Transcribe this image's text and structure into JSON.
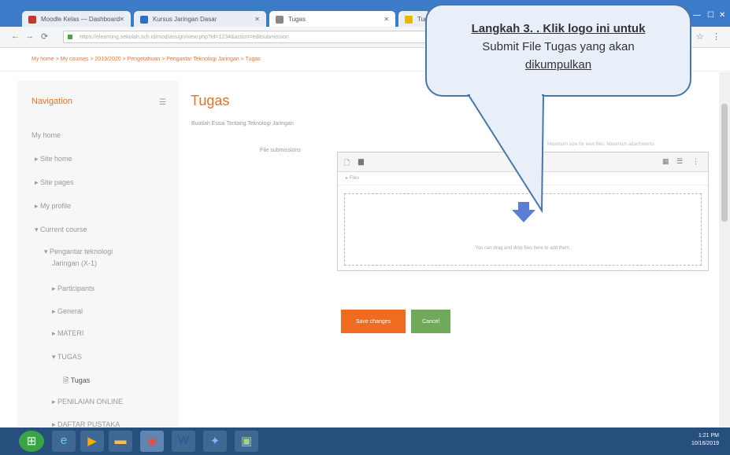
{
  "browser": {
    "tabs": [
      {
        "label": "Moodle Kelas — Dashboard",
        "color": "#c0392b"
      },
      {
        "label": "Kursus Jaringan Dasar",
        "color": "#2e6fbf"
      },
      {
        "label": "Tugas",
        "color": "#888888"
      },
      {
        "label": "Tugas",
        "color": "#e6b800"
      }
    ],
    "url": "https://elearning.sekolah.sch.id/mod/assign/view.php?id=1234&action=editsubmission",
    "breadcrumb": "My home > My courses > 2019/2020 > Pengetahuan > Pengantar Teknologi Jaringan > Tugas"
  },
  "sidebar": {
    "title": "Navigation",
    "items": [
      {
        "label": "My home",
        "indent": 0
      },
      {
        "label": "Site home",
        "indent": 1
      },
      {
        "label": "Site pages",
        "indent": 1
      },
      {
        "label": "My profile",
        "indent": 1
      },
      {
        "label": "Current course",
        "indent": 1
      },
      {
        "label": "Pengantar teknologi",
        "indent": 2
      },
      {
        "label": "Jaringan (X-1)",
        "indent": 3
      },
      {
        "label": "Participants",
        "indent": 3
      },
      {
        "label": "General",
        "indent": 3
      },
      {
        "label": "MATERI",
        "indent": 3
      },
      {
        "label": "TUGAS",
        "indent": 3
      },
      {
        "label": "Tugas",
        "indent": 4
      },
      {
        "label": "PENILAIAN ONLINE",
        "indent": 3
      },
      {
        "label": "DAFTAR PUSTAKA",
        "indent": 3
      }
    ]
  },
  "main": {
    "title": "Tugas",
    "description": "Buatlah Essai Tentang Teknologi Jaringan",
    "submission_label": "File submissions",
    "limits": "Maximum size for new files: Maximum attachments",
    "path": "Files",
    "drop_hint": "You can drag and drop files here to add them.",
    "save_label": "Save changes",
    "cancel_label": "Cancel"
  },
  "callout": {
    "line1": "Langkah 3. . Klik logo ini untuk",
    "line2": "Submit File Tugas yang akan",
    "line3": "dikumpulkan"
  },
  "taskbar": {
    "time": "1:21 PM",
    "date": "10/16/2019"
  },
  "colors": {
    "accent": "#e0742a",
    "save": "#ef6b1f",
    "cancel": "#6fa959",
    "upload_icon": "#5b7ed1"
  }
}
